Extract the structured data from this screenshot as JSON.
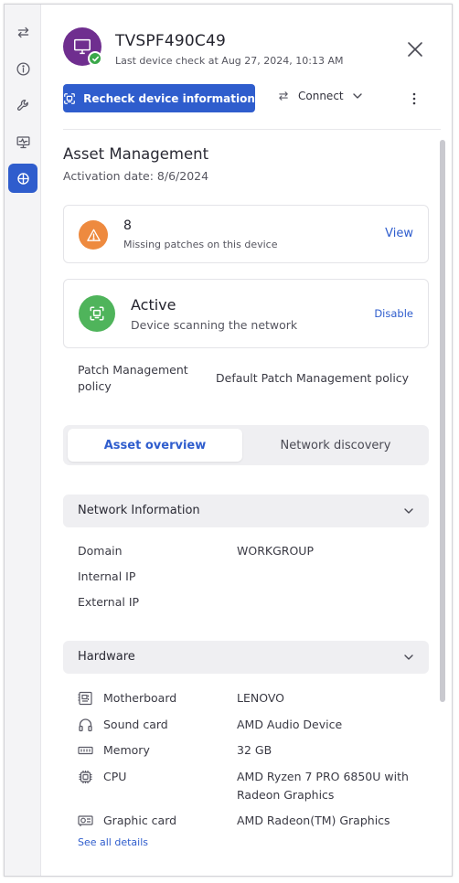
{
  "rail": {
    "items": [
      {
        "name": "swap-arrows-icon",
        "active": false
      },
      {
        "name": "info-icon",
        "active": false
      },
      {
        "name": "wrench-icon",
        "active": false
      },
      {
        "name": "monitor-activity-icon",
        "active": false
      },
      {
        "name": "asset-grid-icon",
        "active": true
      }
    ]
  },
  "header": {
    "device_name": "TVSPF490C49",
    "last_check": "Last device check at Aug 27, 2024, 10:13 AM",
    "avatar_icon": "monitor-icon",
    "status_badge_icon": "check-icon",
    "recheck_label": "Recheck device information",
    "connect_label": "Connect"
  },
  "asset": {
    "title": "Asset Management",
    "activation": "Activation date: 8/6/2024"
  },
  "patches": {
    "count": "8",
    "label": "Missing patches on this device",
    "action": "View"
  },
  "scanning": {
    "status": "Active",
    "description": "Device scanning the network",
    "action": "Disable"
  },
  "policy": {
    "label": "Patch Management policy",
    "value": "Default Patch Management policy"
  },
  "tabs": {
    "asset_overview": "Asset overview",
    "network_discovery": "Network discovery"
  },
  "network": {
    "title": "Network Information",
    "rows": [
      {
        "label": "Domain",
        "value": "WORKGROUP"
      },
      {
        "label": "Internal IP",
        "value": ""
      },
      {
        "label": "External IP",
        "value": ""
      }
    ]
  },
  "hardware": {
    "title": "Hardware",
    "rows": [
      {
        "icon": "motherboard-icon",
        "label": "Motherboard",
        "value": "LENOVO"
      },
      {
        "icon": "headphones-icon",
        "label": "Sound card",
        "value": "AMD Audio Device"
      },
      {
        "icon": "memory-icon",
        "label": "Memory",
        "value": "32 GB"
      },
      {
        "icon": "cpu-icon",
        "label": "CPU",
        "value": "AMD Ryzen 7 PRO 6850U with Radeon Graphics"
      },
      {
        "icon": "graphic-card-icon",
        "label": "Graphic card",
        "value": "AMD Radeon(TM) Graphics"
      }
    ],
    "see_all": "See all details"
  },
  "colors": {
    "accent": "#2f5dcd",
    "avatar": "#6f2e8f",
    "success": "#4fb45b",
    "warning": "#ee8a3f"
  }
}
